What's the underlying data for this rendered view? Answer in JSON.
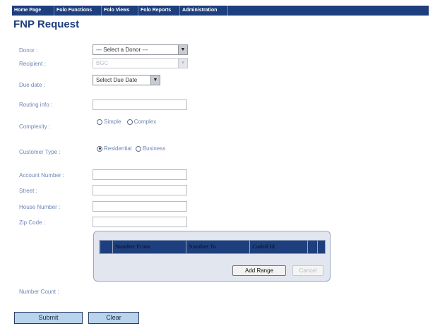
{
  "nav": {
    "items": [
      "Home Page",
      "Folo Functions",
      "Folo Views",
      "Folo Reports",
      "Administration"
    ]
  },
  "page_title": "FNP Request",
  "form": {
    "donor": {
      "label": "Donor :",
      "value": "--- Select a Donor ---"
    },
    "recipient": {
      "label": "Recipient :",
      "value": "BGC"
    },
    "due_date": {
      "label": "Due date :",
      "value": "Select Due Date"
    },
    "routing_info": {
      "label": "Routing info :",
      "value": ""
    },
    "complexity": {
      "label": "Complexity :",
      "options": [
        "Simple",
        "Complex"
      ],
      "selected": null
    },
    "customer_type": {
      "label": "Customer Type :",
      "options": [
        "Residential",
        "Business"
      ],
      "selected": "Residential"
    },
    "account_number": {
      "label": "Account Number :",
      "value": ""
    },
    "street": {
      "label": "Street :",
      "value": ""
    },
    "house_number": {
      "label": "House Number :",
      "value": ""
    },
    "zip_code": {
      "label": "Zip Code :",
      "value": ""
    },
    "number_count": {
      "label": "Number Count :"
    }
  },
  "range_table": {
    "columns": [
      "Number From",
      "Number To",
      "Coded Id"
    ],
    "add_range_label": "Add Range",
    "cancel_label": "Cancel"
  },
  "actions": {
    "submit_label": "Submit",
    "clear_label": "Clear"
  },
  "colors": {
    "nav_bg": "#1e3f7d",
    "label_text": "#6f86b4",
    "title": "#1e3f7d",
    "button_bg": "#b9d3ec"
  }
}
